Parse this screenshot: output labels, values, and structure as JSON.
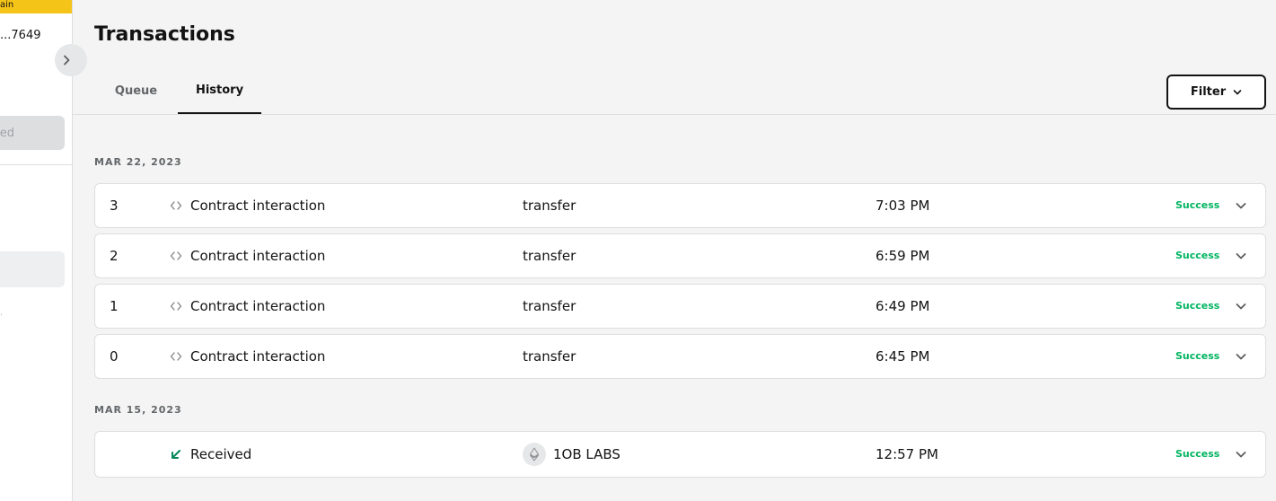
{
  "sidebar": {
    "chain_label": "ain",
    "address": "...7649",
    "new_tx_label": "ed",
    "dot": "."
  },
  "header": {
    "title": "Transactions",
    "tabs": [
      {
        "label": "Queue",
        "active": false
      },
      {
        "label": "History",
        "active": true
      }
    ],
    "filter_label": "Filter"
  },
  "groups": [
    {
      "date": "MAR 22, 2023",
      "rows": [
        {
          "nonce": "3",
          "type": "Contract interaction",
          "icon": "code-icon",
          "info": "transfer",
          "time": "7:03 PM",
          "status": "Success"
        },
        {
          "nonce": "2",
          "type": "Contract interaction",
          "icon": "code-icon",
          "info": "transfer",
          "time": "6:59 PM",
          "status": "Success"
        },
        {
          "nonce": "1",
          "type": "Contract interaction",
          "icon": "code-icon",
          "info": "transfer",
          "time": "6:49 PM",
          "status": "Success"
        },
        {
          "nonce": "0",
          "type": "Contract interaction",
          "icon": "code-icon",
          "info": "transfer",
          "time": "6:45 PM",
          "status": "Success"
        }
      ]
    },
    {
      "date": "MAR 15, 2023",
      "rows": [
        {
          "nonce": "",
          "type": "Received",
          "icon": "received-arrow-icon",
          "info": "1OB LABS",
          "info_icon": "eth-token-icon",
          "time": "12:57 PM",
          "status": "Success"
        }
      ]
    }
  ],
  "colors": {
    "chain_badge": "#f5c418",
    "success": "#00b460",
    "received_arrow": "#00875a"
  }
}
